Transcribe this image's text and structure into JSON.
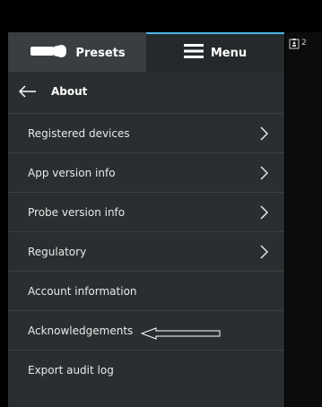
{
  "tabs": [
    {
      "label": "Presets"
    },
    {
      "label": "Menu"
    }
  ],
  "header": {
    "back_title": "About"
  },
  "menu_items": [
    {
      "label": "Registered devices"
    },
    {
      "label": "App version info"
    },
    {
      "label": "Probe version info"
    },
    {
      "label": "Regulatory"
    },
    {
      "label": "Account information"
    },
    {
      "label": "Acknowledgements"
    },
    {
      "label": "Export audit log"
    }
  ],
  "right_panel": {
    "clipboard_text": "2"
  },
  "colors": {
    "accent": "#4fb3e8",
    "panel": "#2b2e30",
    "tab_active_bg": "#26292b",
    "tab_inactive_bg": "#3a3e41"
  },
  "icons": {
    "presets_tab": "probe-icon",
    "menu_tab": "hamburger-icon",
    "back": "back-arrow-icon",
    "chevron": "chevron-right-icon",
    "clipboard": "clipboard-icon",
    "annotation": "hollow-arrow-annotation"
  }
}
